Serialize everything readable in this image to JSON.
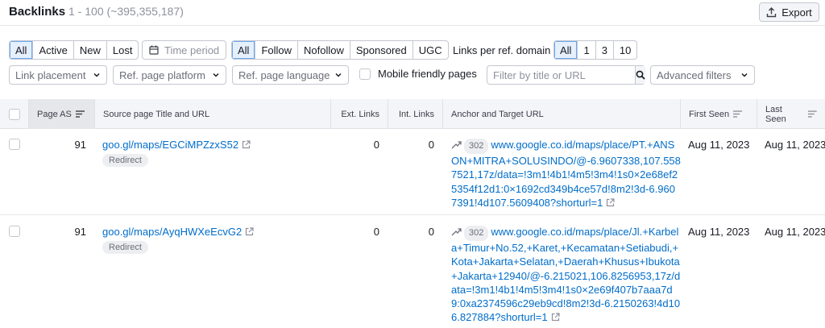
{
  "header": {
    "title": "Backlinks",
    "count": "1 - 100 (~395,355,187)",
    "export_label": "Export"
  },
  "filters": {
    "status": [
      "All",
      "Active",
      "New",
      "Lost"
    ],
    "time_period": "Time period",
    "follow": [
      "All",
      "Follow",
      "Nofollow",
      "Sponsored",
      "UGC"
    ],
    "links_per_domain_label": "Links per ref. domain",
    "links_per_domain": [
      "All",
      "1",
      "3",
      "10"
    ],
    "link_placement": "Link placement",
    "ref_page_platform": "Ref. page platform",
    "ref_page_language": "Ref. page language",
    "mobile_friendly": "Mobile friendly pages",
    "search_placeholder": "Filter by title or URL",
    "advanced_filters": "Advanced filters"
  },
  "table": {
    "columns": {
      "page_as": "Page AS",
      "source": "Source page Title and URL",
      "ext_links": "Ext. Links",
      "int_links": "Int. Links",
      "anchor": "Anchor and Target URL",
      "first_seen": "First Seen",
      "last_seen": "Last Seen"
    },
    "rows": [
      {
        "page_as": "91",
        "source_url": "goo.gl/maps/EGCiMPZzxS52",
        "source_badge": "Redirect",
        "ext_links": "0",
        "int_links": "0",
        "redirect_code": "302",
        "target_url": "www.google.co.id/maps/place/PT.+ANSON+MITRA+SOLUSINDO/@-6.9607338,107.5587521,17z/data=!3m1!4b1!4m5!3m4!1s0×2e68ef25354f12d1:0×1692cd349b4ce57d!8m2!3d-6.9607391!4d107.5609408?shorturl=1",
        "first_seen": "Aug 11, 2023",
        "last_seen": "Aug 11, 2023"
      },
      {
        "page_as": "91",
        "source_url": "goo.gl/maps/AyqHWXeEcvG2",
        "source_badge": "Redirect",
        "ext_links": "0",
        "int_links": "0",
        "redirect_code": "302",
        "target_url": "www.google.co.id/maps/place/Jl.+Karbela+Timur+No.52,+Karet,+Kecamatan+Setiabudi,+Kota+Jakarta+Selatan,+Daerah+Khusus+Ibukota+Jakarta+12940/@-6.215021,106.8256953,17z/data=!3m1!4b1!4m5!3m4!1s0×2e69f407b7aaa7d9:0xa2374596c29eb9cd!8m2!3d-6.2150263!4d106.827884?shorturl=1",
        "first_seen": "Aug 11, 2023",
        "last_seen": "Aug 11, 2023"
      }
    ]
  }
}
